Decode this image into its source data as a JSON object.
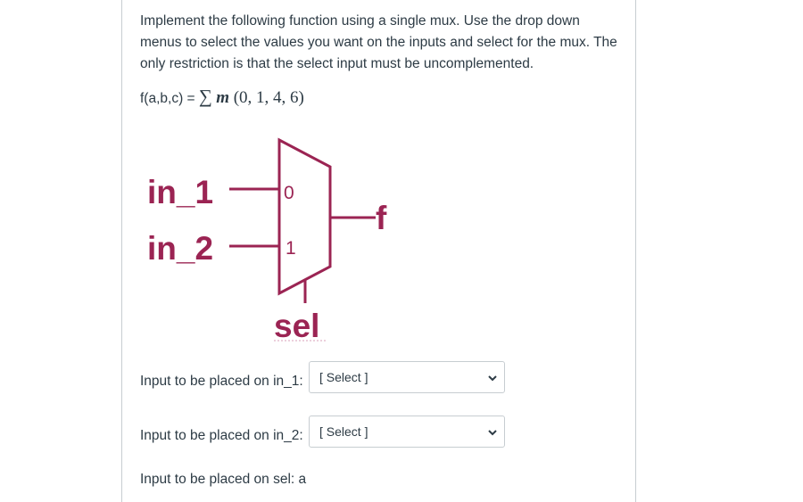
{
  "question": {
    "text": "Implement the following function using a single mux. Use the drop down menus to select the values you want on the inputs and select for the mux. The only restriction is that the select input must be uncomplemented.",
    "formula_prefix": "f(a,b,c) = ",
    "formula_sigma": "∑",
    "formula_m": "m",
    "formula_terms": " (0, 1, 4, 6)"
  },
  "mux": {
    "input_1_label": "in_1",
    "input_2_label": "in_2",
    "port_0": "0",
    "port_1": "1",
    "output_label": "f",
    "select_label": "sel",
    "color": "#9b2453"
  },
  "answers": {
    "in_1_label": "Input to be placed on in_1:",
    "in_1_value": "[ Select ]",
    "in_2_label": "Input to be placed on in_2:",
    "in_2_value": "[ Select ]",
    "sel_label": "Input to be placed on sel: a"
  }
}
